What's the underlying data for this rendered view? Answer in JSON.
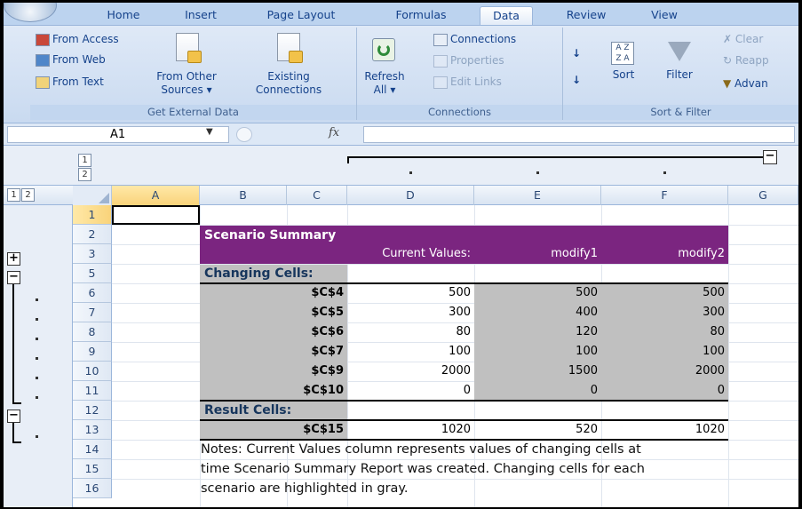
{
  "ribbon": {
    "tabs": [
      "Home",
      "Insert",
      "Page Layout",
      "Formulas",
      "Data",
      "Review",
      "View"
    ],
    "active_tab": "Data",
    "get_external_data": {
      "from_access": "From Access",
      "from_web": "From Web",
      "from_text": "From Text",
      "from_other_sources_line1": "From Other",
      "from_other_sources_line2": "Sources ▾",
      "existing_connections_line1": "Existing",
      "existing_connections_line2": "Connections",
      "group_label": "Get External Data"
    },
    "connections": {
      "refresh_all_line1": "Refresh",
      "refresh_all_line2": "All ▾",
      "connections": "Connections",
      "properties": "Properties",
      "edit_links": "Edit Links",
      "group_label": "Connections"
    },
    "sort_filter": {
      "sort": "Sort",
      "filter": "Filter",
      "clear": "Clear",
      "reapply": "Reapp",
      "advanced": "Advan",
      "group_label": "Sort & Filter"
    }
  },
  "formula_bar": {
    "name_box": "A1",
    "fx": "fx",
    "formula": ""
  },
  "outline": {
    "levels": [
      "1",
      "2"
    ],
    "col_levels": [
      "1",
      "2"
    ]
  },
  "columns": [
    "A",
    "B",
    "C",
    "D",
    "E",
    "F",
    "G"
  ],
  "rows": [
    "1",
    "2",
    "3",
    "5",
    "6",
    "7",
    "8",
    "9",
    "10",
    "11",
    "12",
    "13",
    "14",
    "15",
    "16"
  ],
  "report": {
    "title": "Scenario Summary",
    "col_headers": [
      "Current Values:",
      "modify1",
      "modify2"
    ],
    "changing_cells_label": "Changing Cells:",
    "changing_cells": [
      {
        "name": "$C$4",
        "values": [
          "500",
          "500",
          "500"
        ]
      },
      {
        "name": "$C$5",
        "values": [
          "300",
          "400",
          "300"
        ]
      },
      {
        "name": "$C$6",
        "values": [
          "80",
          "120",
          "80"
        ]
      },
      {
        "name": "$C$7",
        "values": [
          "100",
          "100",
          "100"
        ]
      },
      {
        "name": "$C$9",
        "values": [
          "2000",
          "1500",
          "2000"
        ]
      },
      {
        "name": "$C$10",
        "values": [
          "0",
          "0",
          "0"
        ]
      }
    ],
    "result_cells_label": "Result Cells:",
    "result_cells": [
      {
        "name": "$C$15",
        "values": [
          "1020",
          "520",
          "1020"
        ]
      }
    ],
    "notes": [
      "Notes:  Current Values column represents values of changing cells at",
      "time Scenario Summary Report was created.  Changing cells for each",
      "scenario are highlighted in gray."
    ]
  },
  "colors": {
    "header_purple": "#7b2580",
    "scenario_gray": "#c0c0c0",
    "ribbon_blue": "#dfe9f7"
  }
}
